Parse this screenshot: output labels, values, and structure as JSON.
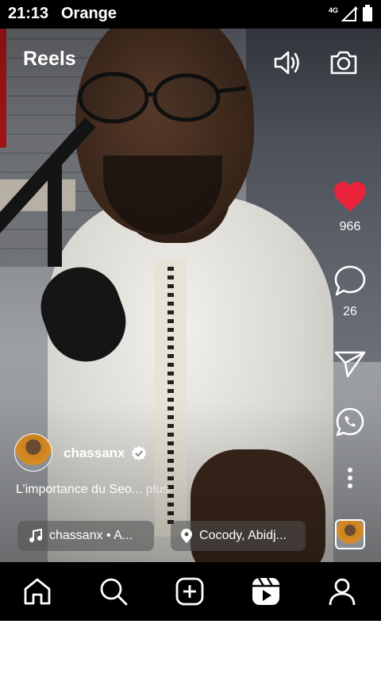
{
  "status_bar": {
    "time": "21:13",
    "carrier": "Orange",
    "network": "4G",
    "icons": [
      "network-signal-icon",
      "battery-icon"
    ]
  },
  "header": {
    "title": "Reels",
    "icons": [
      "volume-icon",
      "camera-icon"
    ]
  },
  "actions": {
    "likes": "966",
    "comments": "26",
    "like_color": "#e8233a",
    "icons": [
      "heart-icon",
      "comment-icon",
      "share-icon",
      "whatsapp-icon",
      "more-icon"
    ]
  },
  "post": {
    "username": "chassanx",
    "verified_icon": "verified-badge-icon",
    "caption": "L’importance du Seo...",
    "caption_more": "plus",
    "audio_label": "chassanx • A...",
    "location_label": "Cocody, Abidj..."
  },
  "bottom_nav": {
    "items": [
      "home-icon",
      "search-icon",
      "create-icon",
      "reels-icon",
      "profile-icon"
    ]
  }
}
